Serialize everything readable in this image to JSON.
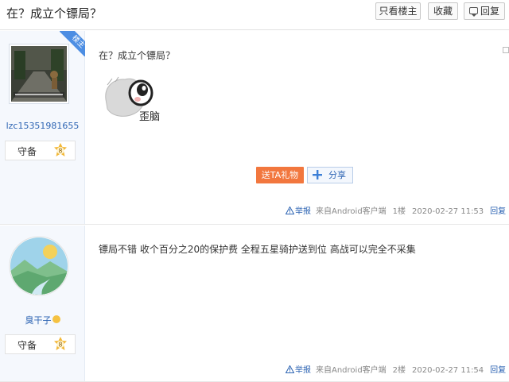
{
  "thread": {
    "title": "在？成立个镖局？"
  },
  "toolbar": {
    "only_lz": "只看楼主",
    "favorite": "收藏",
    "reply": "回复"
  },
  "posts": [
    {
      "username": "lzc15351981655",
      "level_name": "守备",
      "level_num": "8",
      "is_lz_badge": "楼主",
      "text": "在？成立个镖局？",
      "sticker_caption": "歪脑",
      "gift_label": "送TA礼物",
      "share_label": "分享",
      "report": "举报",
      "from": "来自Android客户端",
      "floor": "1楼",
      "time": "2020-02-27 11:53",
      "reply": "回复"
    },
    {
      "username": "臭干子",
      "level_name": "守备",
      "level_num": "8",
      "text": "镖局不错 收个百分之20的保护费 全程五星骑护送到位 高战可以完全不采集",
      "report": "举报",
      "from": "来自Android客户端",
      "floor": "2楼",
      "time": "2020-02-27 11:54",
      "reply": "回复"
    }
  ],
  "colors": {
    "link": "#2d64b3",
    "gift": "#f2773e",
    "lz_ribbon": "#4d8ee3",
    "sidebar_bg": "#f5f8fd"
  }
}
